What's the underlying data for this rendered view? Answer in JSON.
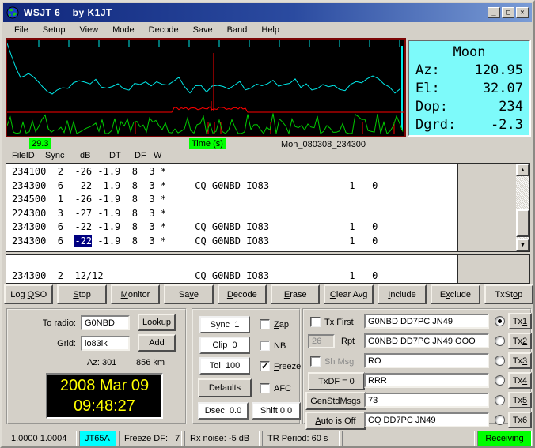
{
  "window": {
    "title": "WSJT 6    by K1JT"
  },
  "window_buttons": {
    "minimize": "_",
    "maximize": "□",
    "close": "✕"
  },
  "menu": {
    "items": [
      "File",
      "Setup",
      "View",
      "Mode",
      "Decode",
      "Save",
      "Band",
      "Help"
    ]
  },
  "spectrum": {
    "freq_label": "29.3",
    "axis_label": "Time (s)",
    "file_label": "Mon_080308_234300",
    "colors": {
      "trace_cyan": "#00e8e8",
      "trace_red": "#ff0000",
      "trace_green": "#00cc00",
      "bg": "#000000",
      "border": "#7b0505",
      "label_bg": "#00ff00"
    }
  },
  "moon": {
    "bg": "#7dfafa",
    "title": "Moon",
    "rows": [
      {
        "label": "Az:",
        "value": "120.95"
      },
      {
        "label": "El:",
        "value": "32.07"
      },
      {
        "label": "Dop:",
        "value": "234"
      },
      {
        "label": "Dgrd:",
        "value": "-2.3"
      }
    ]
  },
  "decoder": {
    "headers": [
      "FileID",
      "Sync",
      "dB",
      "DT",
      "DF",
      "W"
    ],
    "rows": [
      "234100  2  -26 -1.9  8  3 *",
      "234300  6  -22 -1.9  8  3 *     CQ G0NBD IO83              1   0",
      "234500  1  -26 -1.9  8  3 *",
      "224300  3  -27 -1.9  8  3 *",
      "234300  6  -22 -1.9  8  3 *     CQ G0NBD IO83              1   0"
    ],
    "selected_row": {
      "pre": "234300  6  ",
      "sel": "-22",
      "post": " -1.9  8  3 *     CQ G0NBD IO83              1   0"
    },
    "avg_row": "234300  2  12/12                CQ G0NBD IO83              1   0"
  },
  "action_buttons": [
    {
      "pre": "Log ",
      "key": "Q",
      "post": "SO"
    },
    {
      "pre": "",
      "key": "S",
      "post": "top"
    },
    {
      "pre": "",
      "key": "M",
      "post": "onitor"
    },
    {
      "pre": "Sa",
      "key": "v",
      "post": "e"
    },
    {
      "pre": "",
      "key": "D",
      "post": "ecode"
    },
    {
      "pre": "",
      "key": "E",
      "post": "rase"
    },
    {
      "pre": "",
      "key": "C",
      "post": "lear Avg"
    },
    {
      "pre": "",
      "key": "I",
      "post": "nclude"
    },
    {
      "pre": "E",
      "key": "x",
      "post": "clude"
    },
    {
      "pre": "TxSt",
      "key": "o",
      "post": "p"
    }
  ],
  "controls_left": {
    "to_radio_label": "To radio:",
    "to_radio_value": "G0NBD",
    "lookup": {
      "pre": "",
      "key": "L",
      "post": "ookup"
    },
    "grid_label": "Grid:",
    "grid_value": "io83lk",
    "add_label": "Add",
    "az": "Az: 301",
    "distance": "856 km",
    "clock": {
      "date": "2008 Mar 09",
      "time": "09:48:27"
    }
  },
  "controls_mid": {
    "sync": "Sync  1",
    "clip": "Clip  0",
    "tol": "Tol  100",
    "defaults": "Defaults",
    "dsec": "Dsec  0.0",
    "shift": "Shift 0.0",
    "zap": {
      "pre": "",
      "key": "Z",
      "post": "ap",
      "checked": false
    },
    "nb": {
      "pre": "",
      "key": "",
      "post": "NB",
      "checked": false
    },
    "freeze": {
      "pre": "",
      "key": "F",
      "post": "reeze",
      "checked": true
    },
    "afc": {
      "pre": "",
      "key": "",
      "post": "AFC",
      "checked": false
    }
  },
  "controls_right": {
    "tx_first": {
      "label": "Tx First",
      "checked": false
    },
    "rpt_value": "26",
    "rpt_label": "Rpt",
    "sh_msg": {
      "label": "Sh Msg",
      "checked": false
    },
    "txdf_btn": "TxDF = 0",
    "gen_btn": {
      "pre": "",
      "key": "G",
      "post": "enStdMsgs"
    },
    "auto_btn": {
      "pre": "",
      "key": "A",
      "post": "uto is Off"
    },
    "tx_rows": [
      {
        "msg": "G0NBD DD7PC JN49",
        "btn_pre": "Tx",
        "btn_key": "1",
        "selected": true
      },
      {
        "msg": "G0NBD DD7PC JN49 OOO",
        "btn_pre": "Tx",
        "btn_key": "2",
        "selected": false
      },
      {
        "msg": "RO",
        "btn_pre": "Tx",
        "btn_key": "3",
        "selected": false
      },
      {
        "msg": "RRR",
        "btn_pre": "Tx",
        "btn_key": "4",
        "selected": false
      },
      {
        "msg": "73",
        "btn_pre": "Tx",
        "btn_key": "5",
        "selected": false
      },
      {
        "msg": "CQ DD7PC JN49",
        "btn_pre": "Tx",
        "btn_key": "6",
        "selected": false
      }
    ]
  },
  "status_bar": {
    "calib": "1.0000 1.0004",
    "mode": "JT65A",
    "mode_bg": "#00ffff",
    "freeze_df": "Freeze DF:   7",
    "rx_noise": "Rx noise: -5 dB",
    "tr_period": "TR Period: 60 s",
    "state": "Receiving",
    "state_bg": "#00ff00"
  }
}
